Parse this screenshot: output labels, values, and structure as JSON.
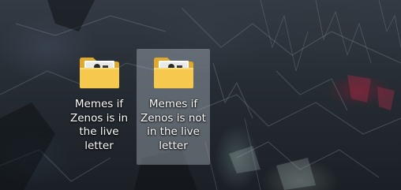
{
  "desktop": {
    "icons": [
      {
        "label": "Memes if\nZenos is in\nthe live letter",
        "icon": "folder-icon",
        "selected": false
      },
      {
        "label": "Memes if\nZenos is not\nin the live\nletter",
        "icon": "folder-icon",
        "selected": true
      }
    ]
  },
  "colors": {
    "folder_front": "#f6c94e",
    "folder_back": "#e0a92a",
    "selection_highlight": "#bec8d2"
  }
}
